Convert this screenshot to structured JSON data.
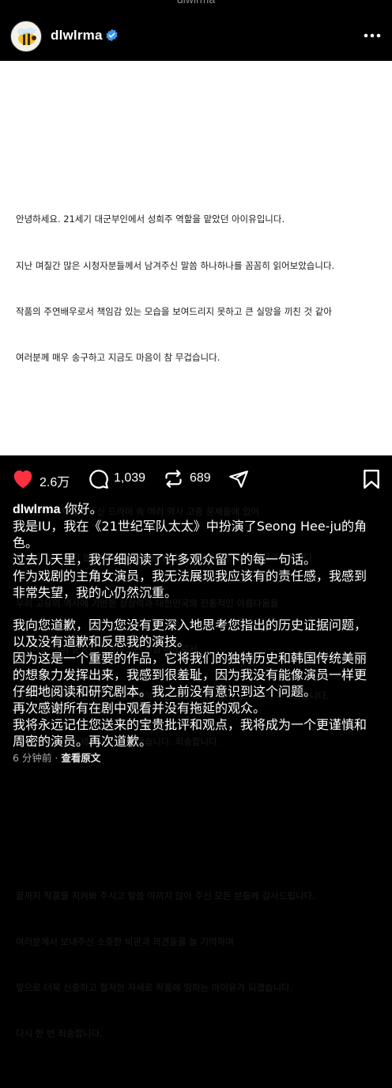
{
  "status_bar": {
    "text": "dlwlrma"
  },
  "header": {
    "username": "dlwlrma",
    "verified_icon": "verified-badge-icon",
    "more_icon": "more-horizontal-icon"
  },
  "post_image": {
    "paragraphs": [
      [
        "안녕하세요. 21세기 대군부인에서 성희주 역할을 맡았던 아이유입니다.",
        "지난 며칠간 많은 시청자분들께서 남겨주신 말씀 하나하나를 꼼꼼히 읽어보았습니다.",
        "작품의 주연배우로서 책임감 있는 모습을 보여드리지 못하고 큰 실망을 끼친 것 같아",
        "여러분께 매우 송구하고 지금도 마음이 참 무겁습니다."
      ],
      [
        "여러분께서 지적해 주신 드라마 속 여러 역사 고증 문제들에 있어",
        "더 깊이 고민하지 않고 연기에 임한 점 변명의 여지없이 반성하고 사과드립니다.",
        "우리 고유의 역사에 기반한 상상력과 대한민국의 전통적인 아름다움을",
        "담아내는 것이 중요한 작품이었던 만큼 배우로서",
        "더욱 신중하게 대본을 읽고 공부해야 했음에도 그러지 못한 스스로가 부끄럽습니다.",
        "미리 문제의식을 제대로 갖지 못했습니다. 죄송합니다."
      ],
      [
        "끝까지 작품을 지켜봐 주시고 말씀 아끼지 않아 주신 모든 분들께 감사드립니다.",
        "여러분께서 보내주신 소중한 비판과 의견들을 늘 기억하며",
        "앞으로 더욱 신중하고 철저한 자세로 작품에 임하는 아이유가 되겠습니다.",
        "다시 한 번 죄송합니다."
      ]
    ]
  },
  "actions": {
    "like_count": "2.6万",
    "comment_count": "1,039",
    "repost_count": "689",
    "like_color": "#ff3040"
  },
  "caption": {
    "username": "dlwlrma",
    "greeting": "你好。",
    "lines": [
      "我是IU，我在《21世纪军队太太》中扮演了Seong Hee-ju的角",
      "色。",
      "过去几天里，我仔细阅读了许多观众留下的每一句话。",
      "作为戏剧的主角女演员，我无法展现我应该有的责任感，我感到",
      "非常失望，我的心仍然沉重。"
    ],
    "lines2": [
      "我向您道歉，因为您没有更深入地思考您指出的历史证据问题，",
      "以及没有道歉和反思我的演技。",
      "因为这是一个重要的作品，它将我们的独特历史和韩国传统美丽",
      "的想象力发挥出来，我感到很羞耻，因为我没有能像演员一样更",
      "仔细地阅读和研究剧本。我之前没有意识到这个问题。",
      "再次感谢所有在剧中观看并没有拖延的观众。",
      "我将永远记住您送来的宝贵批评和观点，我将成为一个更谨慎和",
      "周密的演员。再次道歉。"
    ]
  },
  "footer": {
    "time": "6 分钟前",
    "separator": " · ",
    "see_original": "查看原文"
  }
}
